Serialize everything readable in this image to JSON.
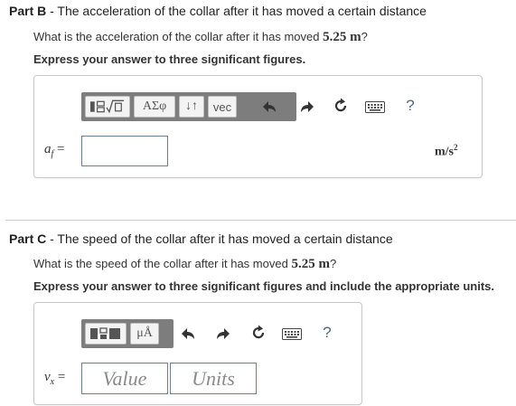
{
  "part_b": {
    "label": "Part B",
    "title": " - The acceleration of the collar after it has moved a certain distance",
    "question_prefix": "What is the acceleration of the collar after it has moved ",
    "question_value": "5.25",
    "question_unit": "m",
    "question_suffix": "?",
    "instruction": "Express your answer to three significant figures.",
    "toolbar": {
      "buttons": [
        "ΑΣφ",
        "↓↑",
        "vec"
      ],
      "icons": [
        "templates-icon",
        "undo-icon",
        "redo-icon",
        "reset-icon",
        "keyboard-icon",
        "help-icon"
      ],
      "help_label": "?"
    },
    "variable": "a",
    "variable_sub": "f",
    "equals": " =",
    "answer_value": "",
    "units": "m/s",
    "units_exp": "2"
  },
  "part_c": {
    "label": "Part C",
    "title": " - The speed of the collar after it has moved a certain distance",
    "question_prefix": "What is the speed of the collar after it has moved ",
    "question_value": "5.25",
    "question_unit": "m",
    "question_suffix": "?",
    "instruction": "Express your answer to three significant figures and include the appropriate units.",
    "toolbar": {
      "buttons": [
        "μÅ"
      ],
      "icons": [
        "templates-icon",
        "undo-icon",
        "redo-icon",
        "reset-icon",
        "keyboard-icon",
        "help-icon"
      ],
      "help_label": "?"
    },
    "variable": "v",
    "variable_sub": "x",
    "equals": " =",
    "value_placeholder": "Value",
    "units_placeholder": "Units"
  },
  "colors": {
    "toolbar_bg": "#7d7d7d",
    "input_border": "#6a7f94",
    "help": "#4a6a8a"
  }
}
